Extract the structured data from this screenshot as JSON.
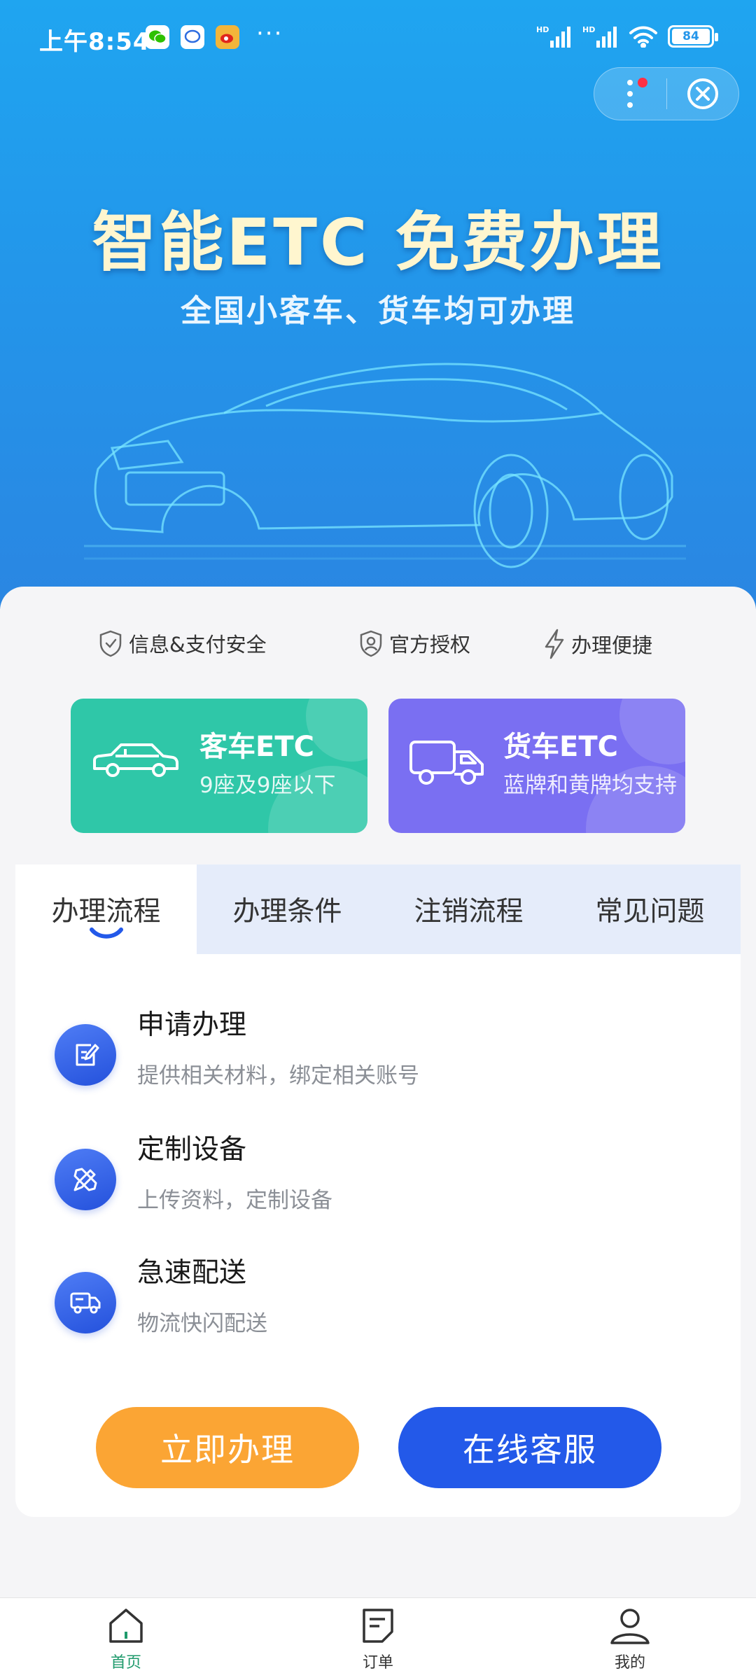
{
  "status_bar": {
    "time": "上午8:54",
    "more_dots": "···",
    "battery": "84",
    "signal_label": "HD",
    "icons": [
      "wechat-icon",
      "message-icon",
      "weibo-icon",
      "signal-icon",
      "signal-icon",
      "wifi-icon",
      "battery-icon"
    ]
  },
  "hero": {
    "title": "智能ETC 免费办理",
    "subtitle": "全国小客车、货车均可办理"
  },
  "features": [
    {
      "label": "信息&支付安全",
      "icon": "shield-check-icon"
    },
    {
      "label": "官方授权",
      "icon": "shield-user-icon"
    },
    {
      "label": "办理便捷",
      "icon": "lightning-icon"
    }
  ],
  "etc_cards": [
    {
      "title": "客车ETC",
      "subtitle": "9座及9座以下",
      "icon": "car-icon",
      "color": "#2fc7a8"
    },
    {
      "title": "货车ETC",
      "subtitle": "蓝牌和黄牌均支持",
      "icon": "truck-icon",
      "color": "#7a6ff2"
    }
  ],
  "tabs": [
    {
      "label": "办理流程",
      "active": true
    },
    {
      "label": "办理条件",
      "active": false
    },
    {
      "label": "注销流程",
      "active": false
    },
    {
      "label": "常见问题",
      "active": false
    }
  ],
  "steps": [
    {
      "title": "申请办理",
      "desc": "提供相关材料，绑定相关账号",
      "icon": "edit-icon"
    },
    {
      "title": "定制设备",
      "desc": "上传资料，定制设备",
      "icon": "tools-icon"
    },
    {
      "title": "急速配送",
      "desc": "物流快闪配送",
      "icon": "delivery-truck-icon"
    }
  ],
  "buttons": {
    "apply": "立即办理",
    "service": "在线客服",
    "apply_color": "#fba534",
    "service_color": "#2359e9"
  },
  "bottom_nav": [
    {
      "label": "首页",
      "icon": "home-icon",
      "active": true
    },
    {
      "label": "订单",
      "icon": "order-icon",
      "active": false
    },
    {
      "label": "我的",
      "icon": "user-icon",
      "active": false
    }
  ]
}
